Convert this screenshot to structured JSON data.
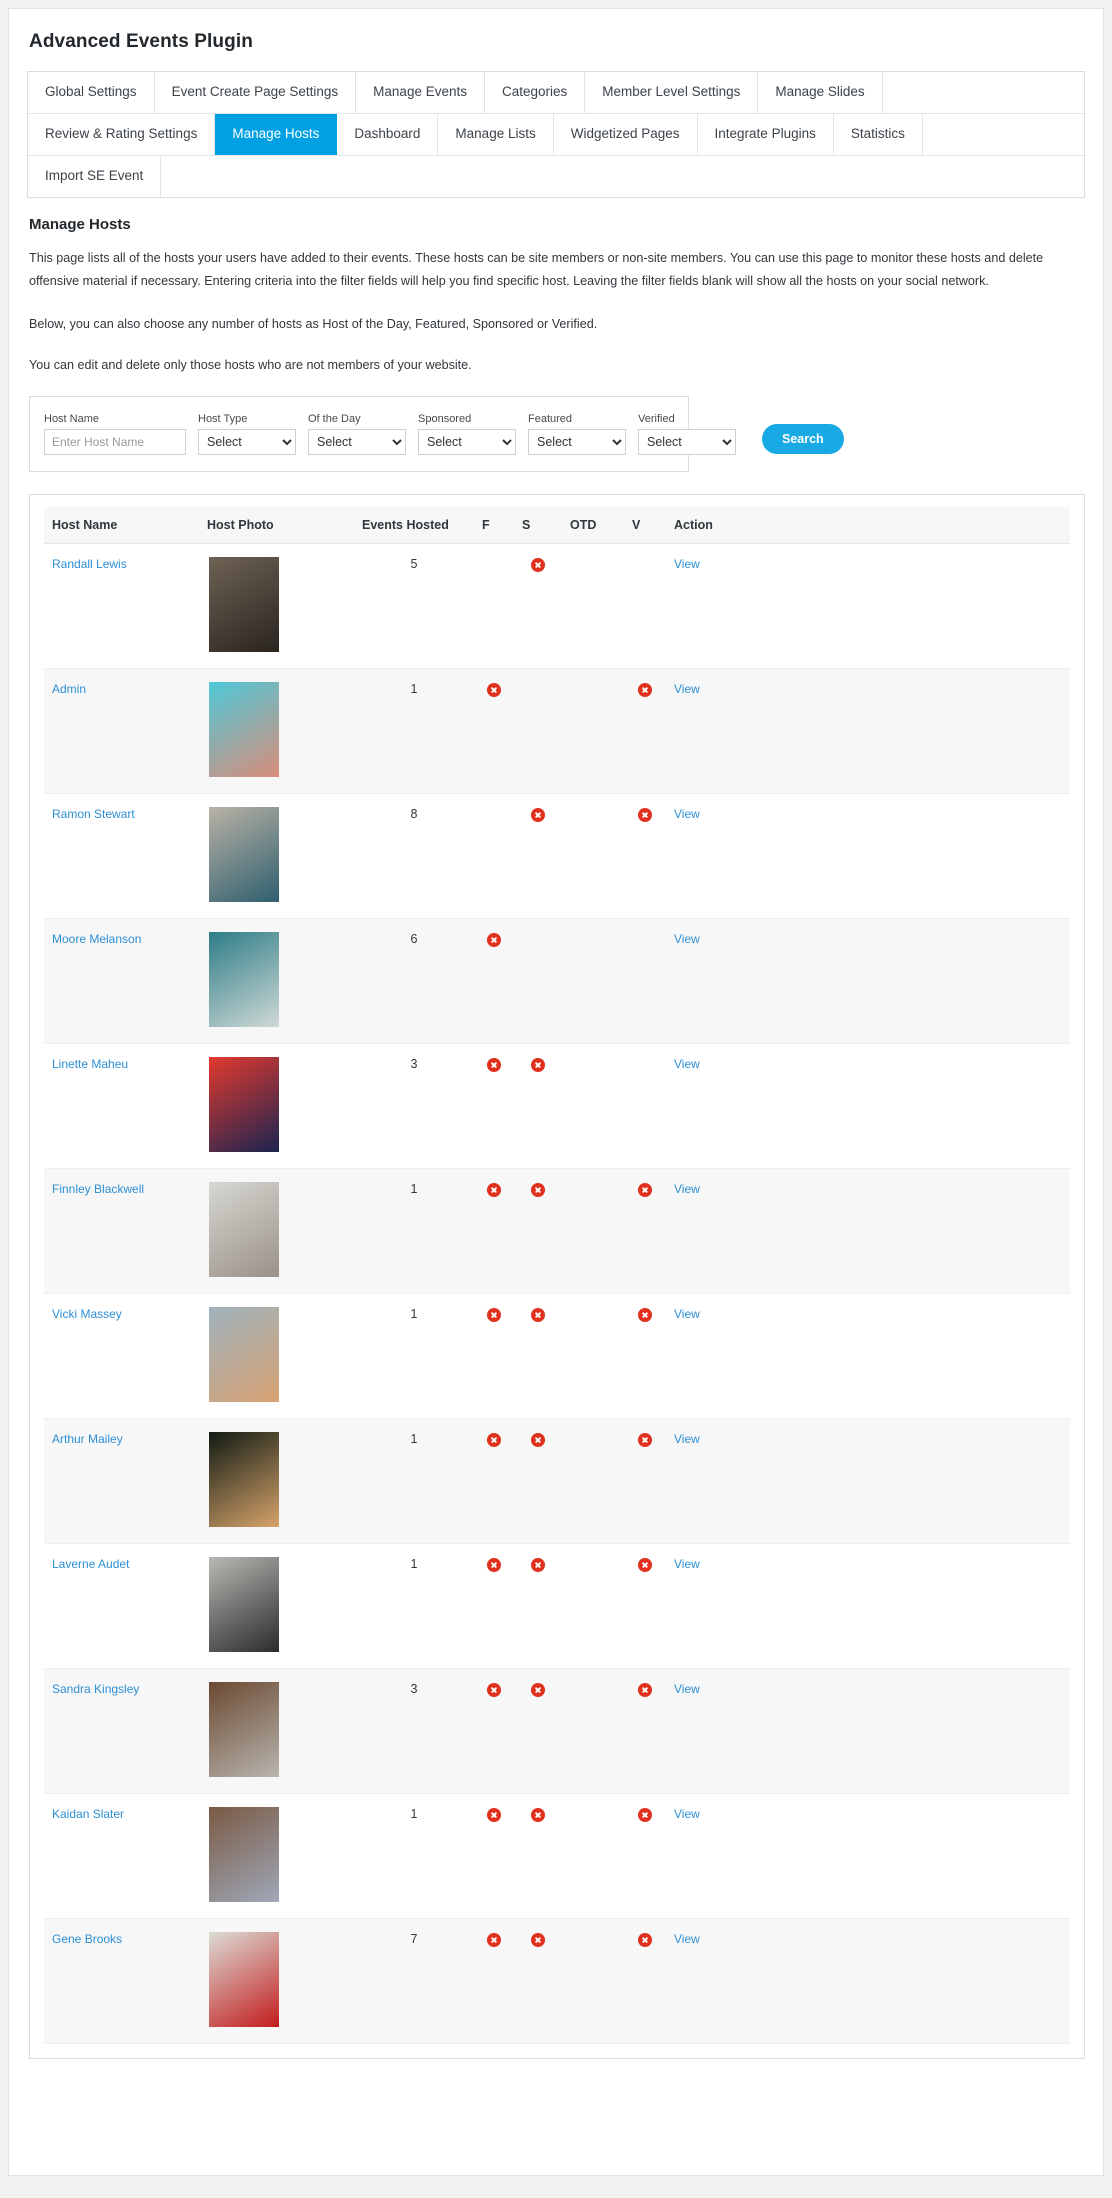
{
  "app": {
    "title": "Advanced Events Plugin",
    "accent_color": "#00a0e3",
    "link_color": "#2d8fd5",
    "danger_color": "#e0301e"
  },
  "tabs": {
    "rows": [
      [
        {
          "label": "Global Settings",
          "active": false
        },
        {
          "label": "Event Create Page Settings",
          "active": false
        },
        {
          "label": "Manage Events",
          "active": false
        },
        {
          "label": "Categories",
          "active": false
        },
        {
          "label": "Member Level Settings",
          "active": false
        },
        {
          "label": "Manage Slides",
          "active": false
        }
      ],
      [
        {
          "label": "Review & Rating Settings",
          "active": false
        },
        {
          "label": "Manage Hosts",
          "active": true
        },
        {
          "label": "Dashboard",
          "active": false
        },
        {
          "label": "Manage Lists",
          "active": false
        },
        {
          "label": "Widgetized Pages",
          "active": false
        },
        {
          "label": "Integrate Plugins",
          "active": false
        },
        {
          "label": "Statistics",
          "active": false
        }
      ],
      [
        {
          "label": "Import SE Event",
          "active": false
        }
      ]
    ]
  },
  "section": {
    "heading": "Manage Hosts",
    "paragraph_1": "This page lists all of the hosts your users have added to their events. These hosts can be site members or non-site members. You can use this page to monitor these hosts and delete offensive material if necessary. Entering criteria into the filter fields will help you find specific host. Leaving the filter fields blank will show all the hosts on your social network.",
    "paragraph_2": "Below, you can also choose any number of hosts as Host of the Day, Featured, Sponsored or Verified.",
    "paragraph_3": "You can edit and delete only those hosts who are not members of your website."
  },
  "filters": {
    "host_name": {
      "label": "Host Name",
      "value": "",
      "placeholder": "Enter Host Name"
    },
    "host_type": {
      "label": "Host Type",
      "selected": "Select",
      "options": [
        "Select"
      ]
    },
    "of_the_day": {
      "label": "Of the Day",
      "selected": "Select",
      "options": [
        "Select"
      ]
    },
    "sponsored": {
      "label": "Sponsored",
      "selected": "Select",
      "options": [
        "Select"
      ]
    },
    "featured": {
      "label": "Featured",
      "selected": "Select",
      "options": [
        "Select"
      ]
    },
    "verified": {
      "label": "Verified",
      "selected": "Select",
      "options": [
        "Select"
      ]
    },
    "search_button": "Search"
  },
  "table": {
    "columns": [
      "Host Name",
      "Host Photo",
      "Events Hosted",
      "F",
      "S",
      "OTD",
      "V",
      "Action"
    ],
    "action_label": "View",
    "rows": [
      {
        "name": "Randall Lewis",
        "events": "5",
        "f": false,
        "s": true,
        "otd": false,
        "v": false,
        "action": "View",
        "photo_a": "#6e6253",
        "photo_b": "#2a2420"
      },
      {
        "name": "Admin",
        "events": "1",
        "f": true,
        "s": false,
        "otd": false,
        "v": true,
        "action": "View",
        "photo_a": "#4ec8d8",
        "photo_b": "#d98d7a"
      },
      {
        "name": "Ramon Stewart",
        "events": "8",
        "f": false,
        "s": true,
        "otd": false,
        "v": true,
        "action": "View",
        "photo_a": "#b9b2a6",
        "photo_b": "#2f5f6e"
      },
      {
        "name": "Moore Melanson",
        "events": "6",
        "f": true,
        "s": false,
        "otd": false,
        "v": false,
        "action": "View",
        "photo_a": "#2e7d87",
        "photo_b": "#cfd9d6"
      },
      {
        "name": "Linette Maheu",
        "events": "3",
        "f": true,
        "s": true,
        "otd": false,
        "v": false,
        "action": "View",
        "photo_a": "#e23a2e",
        "photo_b": "#1b2450"
      },
      {
        "name": "Finnley Blackwell",
        "events": "1",
        "f": true,
        "s": true,
        "otd": false,
        "v": true,
        "action": "View",
        "photo_a": "#d7d7d2",
        "photo_b": "#9a9188"
      },
      {
        "name": "Vicki Massey",
        "events": "1",
        "f": true,
        "s": true,
        "otd": false,
        "v": true,
        "action": "View",
        "photo_a": "#9fb3bd",
        "photo_b": "#d8a273"
      },
      {
        "name": "Arthur Mailey",
        "events": "1",
        "f": true,
        "s": true,
        "otd": false,
        "v": true,
        "action": "View",
        "photo_a": "#111b14",
        "photo_b": "#d6a36a"
      },
      {
        "name": "Laverne Audet",
        "events": "1",
        "f": true,
        "s": true,
        "otd": false,
        "v": true,
        "action": "View",
        "photo_a": "#b7b9b4",
        "photo_b": "#2b2b2b"
      },
      {
        "name": "Sandra Kingsley",
        "events": "3",
        "f": true,
        "s": true,
        "otd": false,
        "v": true,
        "action": "View",
        "photo_a": "#6b4a32",
        "photo_b": "#b8b4ae"
      },
      {
        "name": "Kaidan Slater",
        "events": "1",
        "f": true,
        "s": true,
        "otd": false,
        "v": true,
        "action": "View",
        "photo_a": "#7a5a44",
        "photo_b": "#9fa8b8"
      },
      {
        "name": "Gene Brooks",
        "events": "7",
        "f": true,
        "s": true,
        "otd": false,
        "v": true,
        "action": "View",
        "photo_a": "#dcdcd6",
        "photo_b": "#c21d1d"
      }
    ]
  }
}
